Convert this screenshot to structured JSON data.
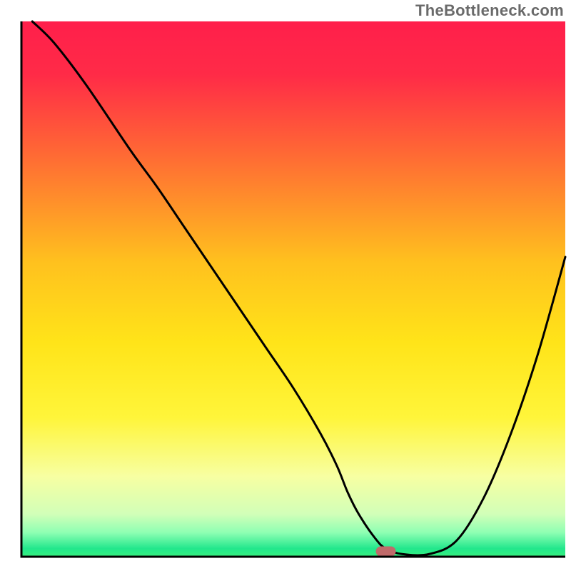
{
  "watermark": "TheBottleneck.com",
  "chart_data": {
    "type": "line",
    "title": "",
    "xlabel": "",
    "ylabel": "",
    "xlim": [
      0,
      100
    ],
    "ylim": [
      0,
      100
    ],
    "grid": false,
    "legend": false,
    "background_gradient_stops": [
      {
        "offset": 0.0,
        "color": "#ff1f4b"
      },
      {
        "offset": 0.1,
        "color": "#ff2b47"
      },
      {
        "offset": 0.25,
        "color": "#ff6a34"
      },
      {
        "offset": 0.45,
        "color": "#ffc11e"
      },
      {
        "offset": 0.6,
        "color": "#ffe419"
      },
      {
        "offset": 0.74,
        "color": "#fff53a"
      },
      {
        "offset": 0.85,
        "color": "#f7ffa2"
      },
      {
        "offset": 0.92,
        "color": "#d2ffb8"
      },
      {
        "offset": 0.955,
        "color": "#8effb3"
      },
      {
        "offset": 0.985,
        "color": "#22e78c"
      },
      {
        "offset": 1.0,
        "color": "#38ef7d"
      }
    ],
    "series": [
      {
        "name": "bottleneck-curve",
        "x": [
          2,
          6,
          12,
          20,
          25,
          30,
          35,
          40,
          45,
          50,
          55,
          58,
          60,
          62,
          65,
          67,
          70,
          75,
          80,
          85,
          90,
          95,
          100
        ],
        "y": [
          100,
          96,
          88,
          76,
          69,
          61.5,
          54,
          46.5,
          39,
          31.5,
          23,
          17,
          12,
          8,
          3.5,
          1.5,
          0.5,
          0.5,
          3,
          11,
          23,
          38,
          56
        ]
      }
    ],
    "marker": {
      "name": "optimal-point",
      "x": 67,
      "y": 1,
      "color": "#c06a6a",
      "rx": 14,
      "ry": 7
    },
    "plot_axes": {
      "color": "#000000",
      "stroke_width": 3
    },
    "curve_style": {
      "color": "#000000",
      "stroke_width": 3
    }
  }
}
